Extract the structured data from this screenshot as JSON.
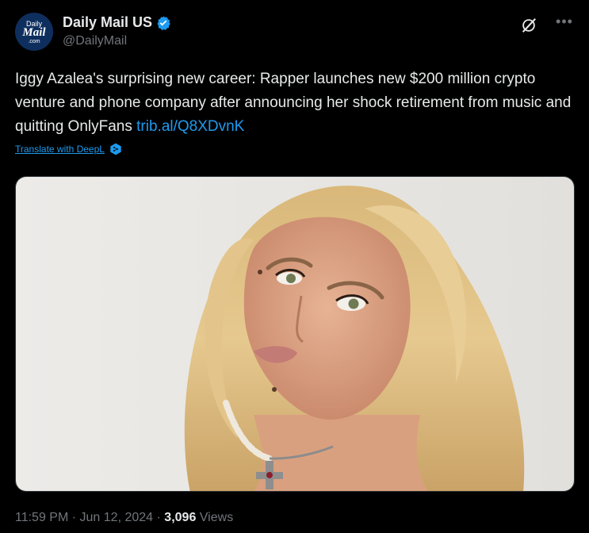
{
  "author": {
    "avatar_line1": "Daily",
    "avatar_line2": "Mail",
    "avatar_line3": ".com",
    "display_name": "Daily Mail US",
    "handle": "@DailyMail",
    "verified": true
  },
  "tweet": {
    "text": "Iggy Azalea's surprising new career: Rapper launches new $200 million crypto venture and phone company after announcing her shock retirement from music and quitting OnlyFans",
    "link": "trib.al/Q8XDvnK",
    "translate_label": "Translate with DeepL"
  },
  "media": {
    "icon": "photo"
  },
  "meta": {
    "time": "11:59 PM",
    "separator": "·",
    "date": "Jun 12, 2024",
    "views_count": "3,096",
    "views_label": "Views"
  },
  "colors": {
    "background": "#000000",
    "text": "#e7e9ea",
    "muted": "#71767b",
    "link": "#1d9bf0",
    "verified": "#1d9bf0"
  }
}
